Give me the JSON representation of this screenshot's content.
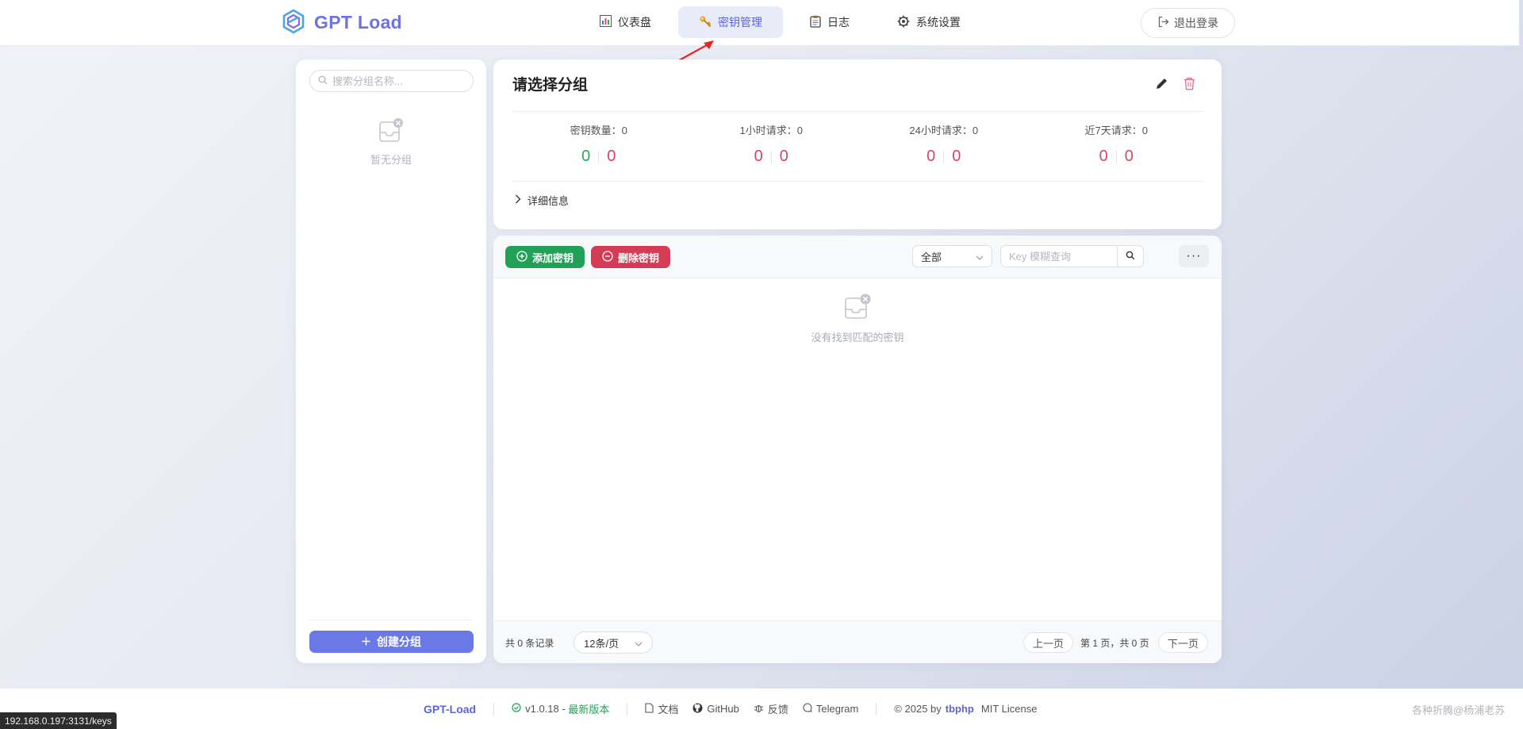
{
  "app": {
    "logo_text": "GPT Load"
  },
  "nav": {
    "items": [
      {
        "label": "仪表盘",
        "icon": "bar-chart-icon"
      },
      {
        "label": "密钥管理",
        "icon": "key-icon",
        "active": true
      },
      {
        "label": "日志",
        "icon": "clipboard-icon"
      },
      {
        "label": "系统设置",
        "icon": "gear-icon"
      }
    ],
    "logout_label": "退出登录"
  },
  "sidebar": {
    "search_placeholder": "搜索分组名称...",
    "empty_text": "暂无分组",
    "create_label": "创建分组"
  },
  "group_info": {
    "title": "请选择分组",
    "stats": [
      {
        "label": "密钥数量：0",
        "values": [
          "0",
          "0"
        ],
        "colors": [
          "green",
          "red"
        ]
      },
      {
        "label": "1小时请求：0",
        "values": [
          "0",
          "0"
        ],
        "colors": [
          "red",
          "red"
        ]
      },
      {
        "label": "24小时请求：0",
        "values": [
          "0",
          "0"
        ],
        "colors": [
          "red",
          "red"
        ]
      },
      {
        "label": "近7天请求：0",
        "values": [
          "0",
          "0"
        ],
        "colors": [
          "red",
          "red"
        ]
      }
    ],
    "details_label": "详细信息"
  },
  "keys": {
    "add_label": "添加密钥",
    "delete_label": "删除密钥",
    "status_filter": "全部",
    "search_placeholder": "Key 模糊查询",
    "more_label": "···",
    "empty_text": "没有找到匹配的密钥",
    "total_text": "共 0 条记录",
    "page_size": "12条/页",
    "prev_label": "上一页",
    "page_info": "第 1 页，共 0 页",
    "next_label": "下一页"
  },
  "footer": {
    "brand": "GPT-Load",
    "version": "v1.0.18",
    "version_sep": " - ",
    "version_status": "最新版本",
    "docs": "文档",
    "github": "GitHub",
    "feedback": "反馈",
    "telegram": "Telegram",
    "copyright_prefix": "© 2025 by",
    "author": "tbphp",
    "license": "MIT License"
  },
  "watermark": "各种折腾@杨浦老苏",
  "status_bar_url": "192.168.0.197:3131/keys",
  "colors": {
    "brand": "#6d73e3",
    "success": "#22a057",
    "danger": "#d43b55"
  }
}
